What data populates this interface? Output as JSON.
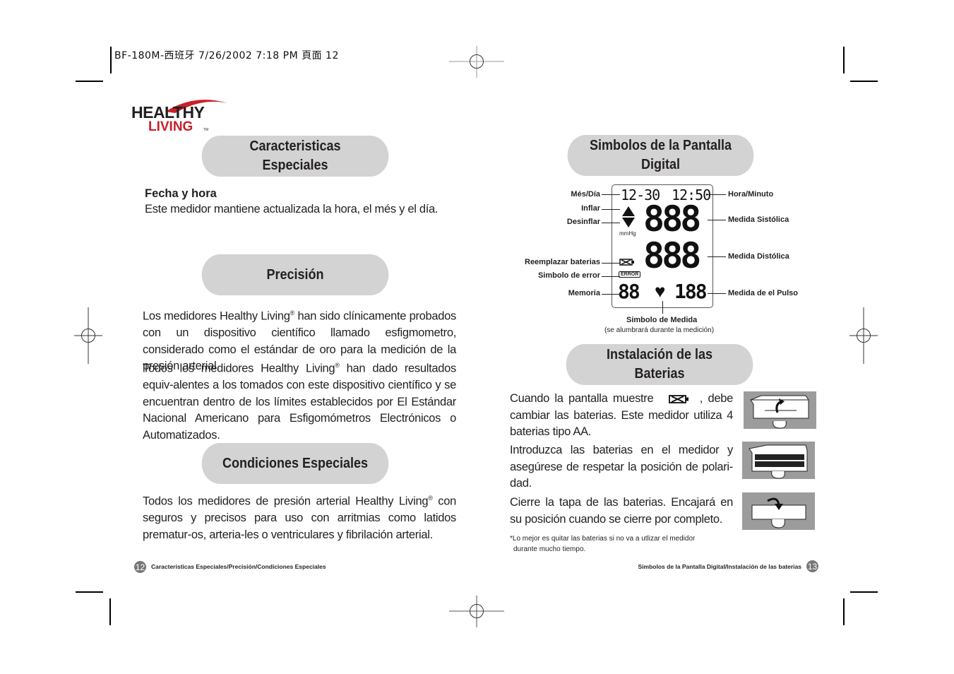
{
  "print_header": "BF-180M-西班牙 7/26/2002 7:18 PM 頁面 12",
  "logo": {
    "line1": "HEALTHY",
    "line2": "LIVING",
    "tm": "TM"
  },
  "left_page": {
    "section1": {
      "title_line1": "Caracteristicas",
      "title_line2": "Especiales",
      "subheading": "Fecha y hora",
      "text": "Este medidor mantiene actualizada la hora, el més y el día."
    },
    "section2": {
      "title": "Precisión",
      "para1_a": "Los medidores Healthy Living",
      "para1_b": " han sido clínicamente probados con un dispositivo científico llamado esfigmometro, considerado como el estándar de oro para la medición de la presión arterial.",
      "para2_a": "Todos los medidores Healthy Living",
      "para2_b": " han dado resultados equiv-alentes a los tomados con este dispositivo científico y se encuentran dentro de los límites establecidos por El Estándar Nacional Americano para Esfigomómetros Electrónicos o Automatizados.",
      "registered": "®"
    },
    "section3": {
      "title": "Condiciones Especiales",
      "para_a": "Todos los medidores de presión arterial Healthy Living",
      "para_b": " con seguros y precisos para uso con arritmias como latidos prematur-os, arteria-les o ventriculares y fibrilación arterial.",
      "registered": "®"
    },
    "footer": {
      "page_number": "12",
      "text": "Caracteristicas Especiales/Precisión/Condiciones Especiales"
    }
  },
  "right_page": {
    "section1": {
      "title_line1": "Simbolos de la Pantalla",
      "title_line2": "Digital",
      "display": {
        "date": "12-30",
        "time": "12:50",
        "systolic": "888",
        "diastolic": "888",
        "memory": "88",
        "pulse": "188",
        "unit": "mmHg",
        "error": "ERROR"
      },
      "labels_left": [
        "Més/Día",
        "Inflar",
        "Desinflar",
        "Reemplazar baterias",
        "Simbolo de error",
        "Memoria"
      ],
      "labels_right": [
        "Hora/Minuto",
        "Medida Sistólica",
        "Medida Distólica",
        "Medida de el Pulso"
      ],
      "bottom_label": "Simbolo de Medida",
      "bottom_sublabel": "(se alumbrará durante la medición)"
    },
    "section2": {
      "title_line1": "Instalación de las",
      "title_line2": "Baterias",
      "step1_a": "Cuando la pantalla muestre",
      "step1_b": ", debe cambiar las baterias. Este medidor utiliza 4 baterias tipo AA.",
      "step2": "Introduzca las baterias en el medidor y asegúrese de respetar la posición de polari-dad.",
      "step3": "Cierre la tapa de las baterias. Encajará en su posición cuando se cierre por completo.",
      "note_line1": "*Lo mejor es quitar las baterias si no va a utlizar el medidor",
      "note_line2": "durante mucho tiempo."
    },
    "footer": {
      "page_number": "13",
      "text": "Simbolos de la Pantalla Digital/Instalación de las baterias"
    }
  },
  "colors": {
    "pill": "#d3d3d3",
    "logo_red": "#c8202a",
    "text": "#231f20",
    "figure_bg": "#9c9c9c"
  }
}
